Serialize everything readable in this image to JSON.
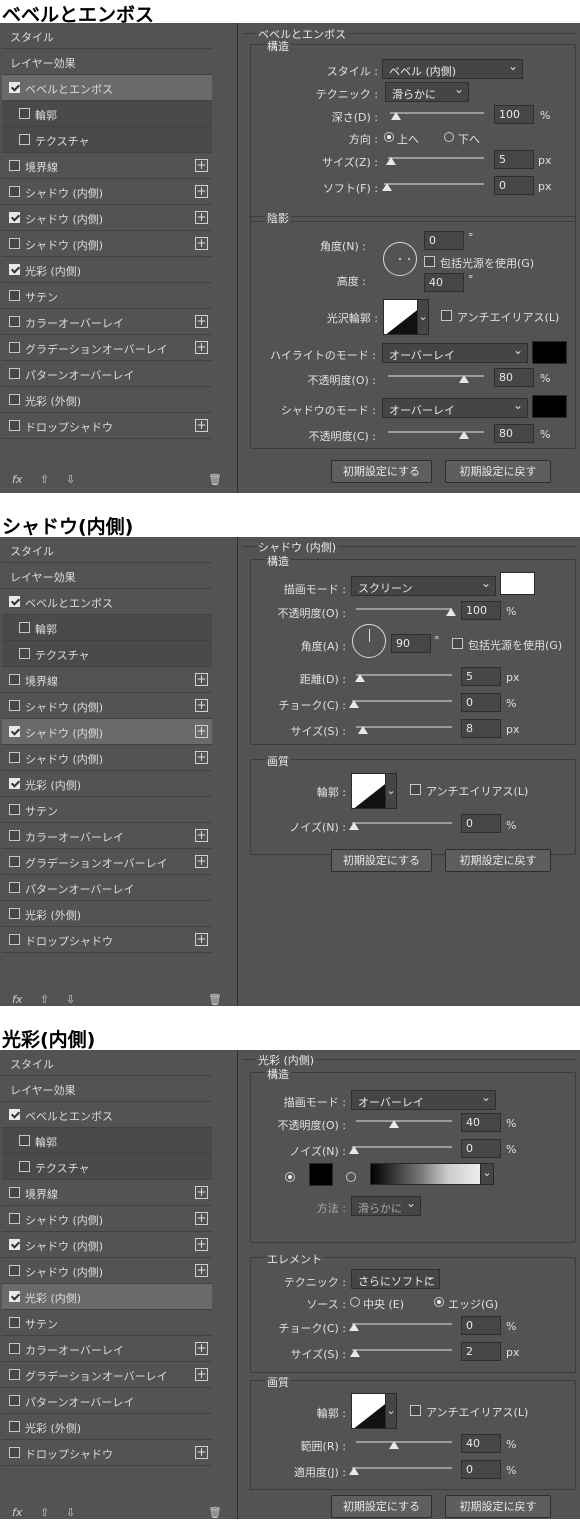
{
  "sections": [
    {
      "title": "ベベルとエンボス",
      "group_title": "ベベルとエンボス",
      "selected_index": 2,
      "sidebar": [
        "スタイル",
        "レイヤー効果",
        "ベベルとエンボス",
        "輪郭",
        "テクスチャ",
        "境界線",
        "シャドウ (内側)",
        "シャドウ (内側)",
        "シャドウ (内側)",
        "光彩 (内側)",
        "サテン",
        "カラーオーバーレイ",
        "グラデーションオーバーレイ",
        "パターンオーバーレイ",
        "光彩 (外側)",
        "ドロップシャドウ"
      ],
      "structure": {
        "title": "構造",
        "style_label": "スタイル :",
        "style_value": "ベベル (内側)",
        "technique_label": "テクニック :",
        "technique_value": "滑らかに",
        "depth_label": "深さ(D) :",
        "depth_value": "100",
        "depth_unit": "%",
        "direction_label": "方向 :",
        "direction_up": "上へ",
        "direction_down": "下へ",
        "size_label": "サイズ(Z) :",
        "size_value": "5",
        "size_unit": "px",
        "soften_label": "ソフト(F) :",
        "soften_value": "0",
        "soften_unit": "px"
      },
      "shading": {
        "title": "陰影",
        "angle_label": "角度(N) :",
        "angle_value": "0",
        "degree": "°",
        "global_light": "包括光源を使用(G)",
        "altitude_label": "高度 :",
        "altitude_value": "40",
        "gloss_label": "光沢輪郭 :",
        "antialias": "アンチエイリアス(L)",
        "highlight_label": "ハイライトのモード :",
        "highlight_mode": "オーバーレイ",
        "highlight_opacity_label": "不透明度(O) :",
        "highlight_opacity": "80",
        "shadow_label": "シャドウのモード :",
        "shadow_mode": "オーバーレイ",
        "shadow_opacity_label": "不透明度(C) :",
        "shadow_opacity": "80",
        "percent": "%"
      },
      "buttons": [
        "初期設定にする",
        "初期設定に戻す"
      ]
    },
    {
      "title": "シャドウ(内側)",
      "group_title": "シャドウ (内側)",
      "selected_index": 7,
      "sidebar": [
        "スタイル",
        "レイヤー効果",
        "ベベルとエンボス",
        "輪郭",
        "テクスチャ",
        "境界線",
        "シャドウ (内側)",
        "シャドウ (内側)",
        "シャドウ (内側)",
        "光彩 (内側)",
        "サテン",
        "カラーオーバーレイ",
        "グラデーションオーバーレイ",
        "パターンオーバーレイ",
        "光彩 (外側)",
        "ドロップシャドウ"
      ],
      "structure": {
        "title": "構造",
        "blend_label": "描画モード :",
        "blend_value": "スクリーン",
        "opacity_label": "不透明度(O) :",
        "opacity_value": "100",
        "percent": "%",
        "angle_label": "角度(A) :",
        "angle_value": "90",
        "degree": "°",
        "global_light": "包括光源を使用(G)",
        "distance_label": "距離(D) :",
        "distance_value": "5",
        "px": "px",
        "choke_label": "チョーク(C) :",
        "choke_value": "0",
        "size_label": "サイズ(S) :",
        "size_value": "8"
      },
      "quality": {
        "title": "画質",
        "contour_label": "輪郭 :",
        "antialias": "アンチエイリアス(L)",
        "noise_label": "ノイズ(N) :",
        "noise_value": "0",
        "percent": "%"
      },
      "buttons": [
        "初期設定にする",
        "初期設定に戻す"
      ]
    },
    {
      "title": "光彩(内側)",
      "group_title": "光彩 (内側)",
      "selected_index": 9,
      "sidebar": [
        "スタイル",
        "レイヤー効果",
        "ベベルとエンボス",
        "輪郭",
        "テクスチャ",
        "境界線",
        "シャドウ (内側)",
        "シャドウ (内側)",
        "シャドウ (内側)",
        "光彩 (内側)",
        "サテン",
        "カラーオーバーレイ",
        "グラデーションオーバーレイ",
        "パターンオーバーレイ",
        "光彩 (外側)",
        "ドロップシャドウ"
      ],
      "structure": {
        "title": "構造",
        "blend_label": "描画モード :",
        "blend_value": "オーバーレイ",
        "opacity_label": "不透明度(O) :",
        "opacity_value": "40",
        "percent": "%",
        "noise_label": "ノイズ(N) :",
        "noise_value": "0",
        "method_label": "方法 :",
        "method_value": "滑らかに"
      },
      "elements": {
        "title": "エレメント",
        "technique_label": "テクニック :",
        "technique_value": "さらにソフトに",
        "source_label": "ソース :",
        "source_center": "中央 (E)",
        "source_edge": "エッジ(G)",
        "choke_label": "チョーク(C) :",
        "choke_value": "0",
        "percent": "%",
        "size_label": "サイズ(S) :",
        "size_value": "2",
        "px": "px"
      },
      "quality": {
        "title": "画質",
        "contour_label": "輪郭 :",
        "antialias": "アンチエイリアス(L)",
        "range_label": "範囲(R) :",
        "range_value": "40",
        "jitter_label": "適用度(J) :",
        "jitter_value": "0",
        "percent": "%"
      },
      "buttons": [
        "初期設定にする",
        "初期設定に戻す"
      ]
    }
  ],
  "checked": [
    false,
    false,
    true,
    false,
    false,
    false,
    false,
    true,
    false,
    true,
    false,
    false,
    false,
    false,
    false,
    false
  ],
  "has_plus": [
    false,
    false,
    false,
    false,
    false,
    true,
    true,
    true,
    true,
    false,
    false,
    true,
    true,
    false,
    false,
    true
  ],
  "footer": {
    "fx": "fx",
    "up": "⇧",
    "down": "⇩",
    "trash": "🗑"
  },
  "colors": {
    "panel": "#535353",
    "highlight_swatch": "#000000",
    "shadow_swatch": "#000000",
    "inner_shadow_swatch": "#ffffff",
    "glow_swatch": "#000000"
  }
}
